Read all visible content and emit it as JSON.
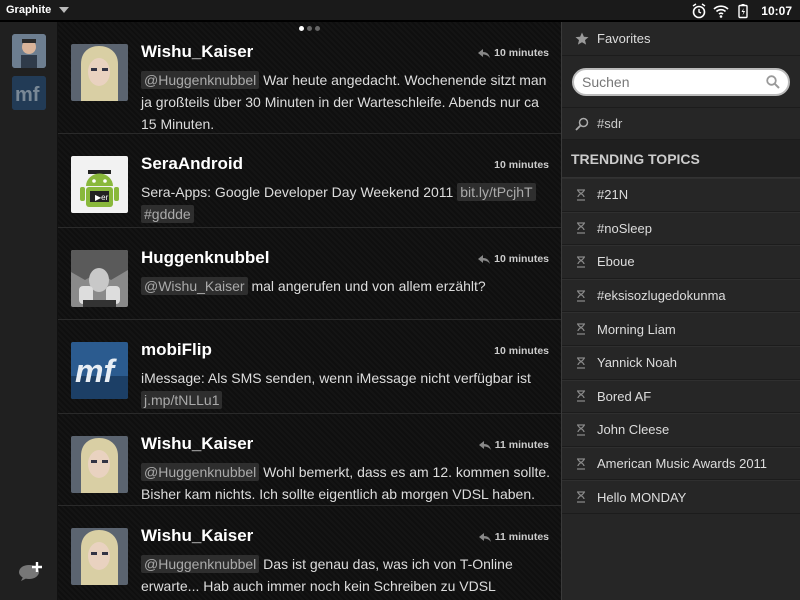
{
  "status": {
    "app_name": "Graphite",
    "time": "10:07"
  },
  "pager": {
    "dots": 3,
    "active": 0
  },
  "tweets": [
    {
      "user": "Wishu_Kaiser",
      "time": "10 minutes",
      "reply": true,
      "mention": "@Huggenknubbel",
      "text": " War heute angedacht. Wochenende sitzt man ja großteils über 30 Minuten in der Warteschleife. Abends nur ca 15 Minuten.",
      "link": ""
    },
    {
      "user": "SeraAndroid",
      "time": "10 minutes",
      "reply": false,
      "mention": "",
      "text": "Sera-Apps: Google Developer Day Weekend 2011 ",
      "link": "bit.ly/tPcjhT",
      "tag": "#gddde"
    },
    {
      "user": "Huggenknubbel",
      "time": "10 minutes",
      "reply": true,
      "mention": "@Wishu_Kaiser",
      "text": " mal angerufen und von allem erzählt?",
      "link": ""
    },
    {
      "user": "mobiFlip",
      "time": "10 minutes",
      "reply": false,
      "mention": "",
      "text": "iMessage: Als SMS senden, wenn iMessage nicht verfügbar ist ",
      "link": "j.mp/tNLLu1"
    },
    {
      "user": "Wishu_Kaiser",
      "time": "11 minutes",
      "reply": true,
      "mention": "@Huggenknubbel",
      "text": " Wohl bemerkt, dass es am 12. kommen sollte. Bisher kam nichts. Ich sollte eigentlich ab morgen VDSL haben.",
      "link": ""
    },
    {
      "user": "Wishu_Kaiser",
      "time": "11 minutes",
      "reply": true,
      "mention": "@Huggenknubbel",
      "text": " Das ist genau das, was ich von T-Online erwarte... Hab auch immer noch kein Schreiben zu VDSL bekommen.",
      "link": ""
    }
  ],
  "panel": {
    "favorites_label": "Favorites",
    "search_placeholder": "Suchen",
    "saved_search": "#sdr",
    "trending_title": "TRENDING TOPICS",
    "topics": [
      "#21N",
      "#noSleep",
      "Eboue",
      "#eksisozlugedokunma",
      "Morning Liam",
      "Yannick Noah",
      "Bored AF",
      "John Cleese",
      "American Music Awards 2011",
      "Hello MONDAY"
    ]
  },
  "colors": {
    "accent": "#ffffff",
    "panel_bg": "#262626",
    "timeline_bg": "#111111"
  }
}
